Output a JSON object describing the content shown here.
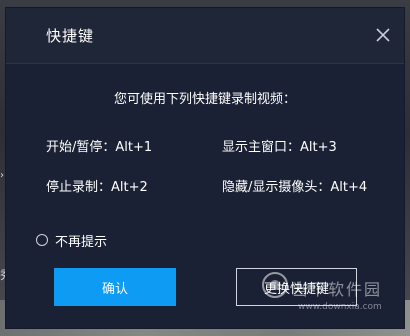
{
  "dialog": {
    "title": "快捷键",
    "intro": "您可使用下列快捷键录制视频：",
    "shortcuts": [
      {
        "label": "开始/暂停：Alt+1"
      },
      {
        "label": "停止录制：Alt+2"
      },
      {
        "label": "显示主窗口：Alt+3"
      },
      {
        "label": "隐藏/显示摄像头：Alt+4"
      }
    ],
    "option_label": "不再提示",
    "confirm_label": "确认",
    "change_label": "更换快捷键"
  },
  "background": {
    "edge_text": "秀",
    "edge_arrow": "›"
  },
  "watermark": {
    "name": "当下软件园",
    "url": "www.downxia.com"
  },
  "colors": {
    "dialog_bg": "#1b2134",
    "titlebar_bg": "#1f2638",
    "accent": "#0e9bf3",
    "text": "#ffffff"
  },
  "icons": {
    "close": "close-icon",
    "radio": "radio-unchecked-icon"
  }
}
